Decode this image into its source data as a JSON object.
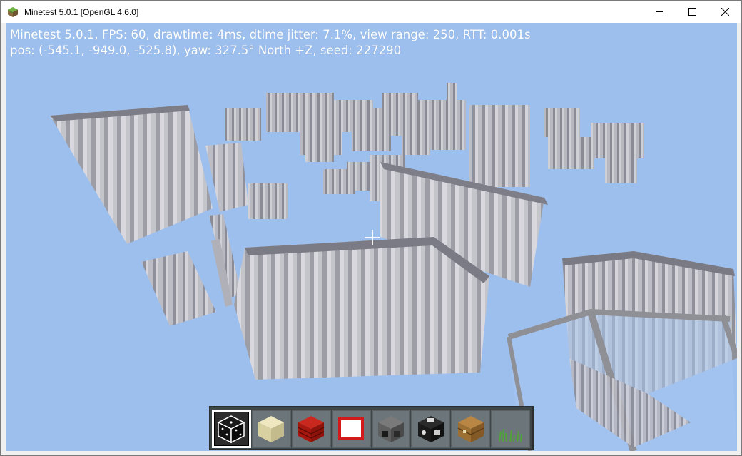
{
  "window": {
    "title": "Minetest 5.0.1 [OpenGL 4.6.0]"
  },
  "hud": {
    "line1": "Minetest 5.0.1, FPS: 60, drawtime: 4ms, dtime jitter: 7.1%, view range: 250, RTT: 0.001s",
    "line2": "pos: (-545.1, -949.0, -525.8), yaw: 327.5° North +Z, seed: 227290"
  },
  "colors": {
    "sky": "#9cbfee",
    "stone_light": "#c9c9cf",
    "stone_dark": "#8d8d96",
    "hotbar_bg": "#3f4648"
  },
  "hotbar": {
    "selected_index": 0,
    "slots": [
      {
        "item": "dice-block-icon"
      },
      {
        "item": "sandstone-block-icon"
      },
      {
        "item": "tnt-block-icon"
      },
      {
        "item": "white-frame-block-icon"
      },
      {
        "item": "furnace-icon"
      },
      {
        "item": "jukebox-icon"
      },
      {
        "item": "chest-icon"
      },
      {
        "item": "grass-icon"
      }
    ]
  }
}
